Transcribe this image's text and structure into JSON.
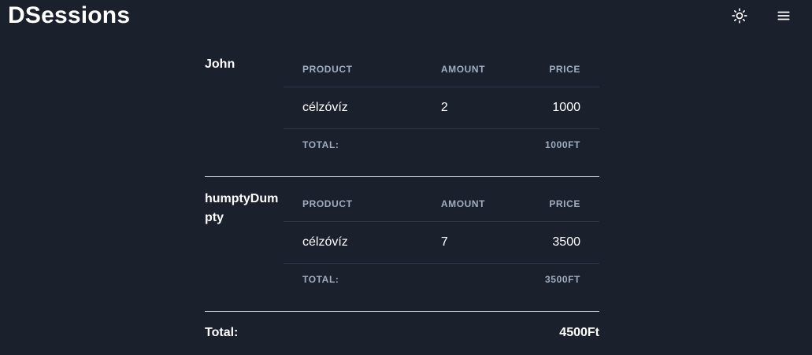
{
  "header": {
    "brand": "DSessions",
    "icons": [
      "sun-icon",
      "hamburger-menu-icon"
    ]
  },
  "table_headers": {
    "product": "PRODUCT",
    "amount": "AMOUNT",
    "price": "PRICE"
  },
  "people": [
    {
      "name": "John",
      "items": [
        {
          "product": "célzóvíz",
          "amount": "2",
          "price": "1000"
        }
      ],
      "total_label": "TOTAL:",
      "total_value": "1000FT"
    },
    {
      "name": "humptyDumpty",
      "items": [
        {
          "product": "célzóvíz",
          "amount": "7",
          "price": "3500"
        }
      ],
      "total_label": "TOTAL:",
      "total_value": "3500FT"
    }
  ],
  "grand_total": {
    "label": "Total:",
    "value": "4500Ft"
  }
}
